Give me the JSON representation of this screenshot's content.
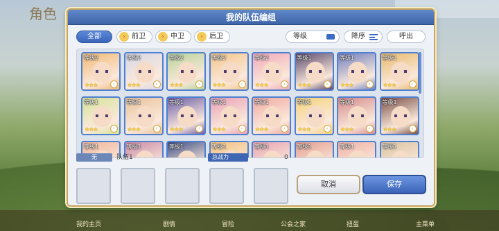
{
  "background": {
    "logo_text": "角色",
    "bottom_nav": [
      "我的主页",
      "剧情",
      "冒险",
      "公会之家",
      "扭蛋",
      "主菜单"
    ]
  },
  "dialog": {
    "title": "我的队伍编组",
    "filters": {
      "tabs": [
        {
          "label": "全部",
          "active": true
        },
        {
          "label": "前卫",
          "active": false
        },
        {
          "label": "中卫",
          "active": false
        },
        {
          "label": "后卫",
          "active": false
        }
      ],
      "sort_label": "等级",
      "order_label": "降序",
      "call_label": "呼出"
    },
    "roster": [
      {
        "level": "等级2",
        "stars": "★★★",
        "color": "#f2b873"
      },
      {
        "level": "等级2",
        "stars": "★★★",
        "color": "#d7d7e6"
      },
      {
        "level": "等级2",
        "stars": "★★★",
        "color": "#b7d39b"
      },
      {
        "level": "等级2",
        "stars": "★★★",
        "color": "#f4c58a"
      },
      {
        "level": "等级2",
        "stars": "★★★",
        "color": "#f1a9b8"
      },
      {
        "level": "等级1",
        "stars": "★★★",
        "color": "#5b4a6e"
      },
      {
        "level": "等级1",
        "stars": "★★★",
        "color": "#6f7fbf"
      },
      {
        "level": "等级1",
        "stars": "★★★",
        "color": "#e8b96a"
      },
      {
        "level": "等级1",
        "stars": "★★★",
        "color": "#d6e39a"
      },
      {
        "level": "等级1",
        "stars": "★★★",
        "color": "#e9c29a"
      },
      {
        "level": "等级1",
        "stars": "★★★",
        "color": "#6d5fa8"
      },
      {
        "level": "等级1",
        "stars": "★★★",
        "color": "#e7a0b5"
      },
      {
        "level": "等级1",
        "stars": "★★★",
        "color": "#f0a9a0"
      },
      {
        "level": "等级1",
        "stars": "★★★",
        "color": "#f4d27a"
      },
      {
        "level": "等级1",
        "stars": "★★★",
        "color": "#d48a8a"
      },
      {
        "level": "等级1",
        "stars": "★★★",
        "color": "#7a5048"
      },
      {
        "level": "等级1",
        "stars": "",
        "color": "#efb59a"
      },
      {
        "level": "等级1",
        "stars": "",
        "color": "#c98aa6"
      },
      {
        "level": "等级1",
        "stars": "",
        "color": "#3e4f86"
      },
      {
        "level": "等级1",
        "stars": "",
        "color": "#f2c07e"
      },
      {
        "level": "等级1",
        "stars": "",
        "color": "#e5a3b0"
      },
      {
        "level": "等级1",
        "stars": "",
        "color": "#e39e8e"
      },
      {
        "level": "等级1",
        "stars": "",
        "color": "#efb2a6"
      },
      {
        "level": "等级1",
        "stars": "",
        "color": "#d9c3a0"
      }
    ],
    "party": {
      "slot_tag": "无",
      "name": "队伍1",
      "power_label": "总战力",
      "power_value": "0"
    },
    "cancel_label": "取消",
    "save_label": "保存"
  }
}
